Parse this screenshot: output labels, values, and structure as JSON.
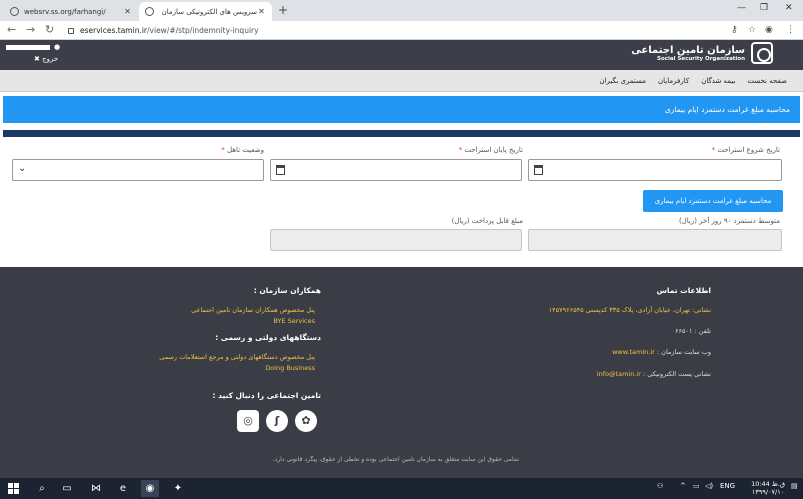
{
  "browser": {
    "tabs": [
      {
        "title": "websrv.ss.org/farhangi/",
        "active": false
      },
      {
        "title": "سرویس های الکترونیکی سازمان تام",
        "active": true
      }
    ],
    "url_host": "eservices.tamin.ir",
    "url_path": "/view/#/stp/indemnity-inquiry"
  },
  "site": {
    "logout": "✖ خروج",
    "logo_fa": "سازمان تامین اجتماعی",
    "logo_en": "Social Security Organization",
    "nav": [
      "صفحه نخست",
      "بیمه شدگان",
      "کارفرمایان",
      "مستمری بگیران"
    ]
  },
  "page": {
    "title": "محاسبه مبلغ غرامت دستمزد ایام بیماری",
    "fields": {
      "start_date_label": "تاریخ شروع استراحت",
      "end_date_label": "تاریخ پایان استراحت",
      "marital_label": "وضعیت تاهل",
      "required_mark": "*",
      "calc_button": "محاسبه مبلغ غرامت دستمزد ایام بیماری",
      "avg_wage_label": "متوسط دستمزد ۹۰ روز آخر (ریال)",
      "payable_label": "مبلغ قابل پرداخت (ریال)"
    }
  },
  "footer": {
    "contact_title": "اطلاعات تماس",
    "address": "نشانی: تهران، خیابان آزادی، پلاک ۳۳۵ کدپستی ۱۴۵۷۹۶۶۵۴۵",
    "phone": "تلفن : ۶۶۵۰۱",
    "website_key": "وب سایت سازمان :",
    "website_val": "www.tamin.ir",
    "email_key": "نشانی پست الکترونیکی :",
    "email_val": "info@tamin.ir",
    "partners_title": "همکاران سازمان :",
    "partners_line1": "پنل مخصوص همکاران سازمان تامین اجتماعی",
    "partners_line2": "BYE Services",
    "gov_title": "دستگاههای دولتی و رسمی :",
    "gov_line1": "پنل مخصوص دستگاههای دولتی و مرجع استعلامات رسمی",
    "gov_line2": "Doing Business",
    "follow_title": "تامین اجتماعی را دنبال کنید :",
    "copyright": "تمامی حقوق این سایت متعلق به سازمان تامین اجتماعی بوده و تخطی از حقوق، پیگرد قانونی دارد."
  },
  "taskbar": {
    "lang": "ENG",
    "time": "10:44 ق.ظ",
    "date": "۱۳۹۹/۰۷/۱۰"
  }
}
